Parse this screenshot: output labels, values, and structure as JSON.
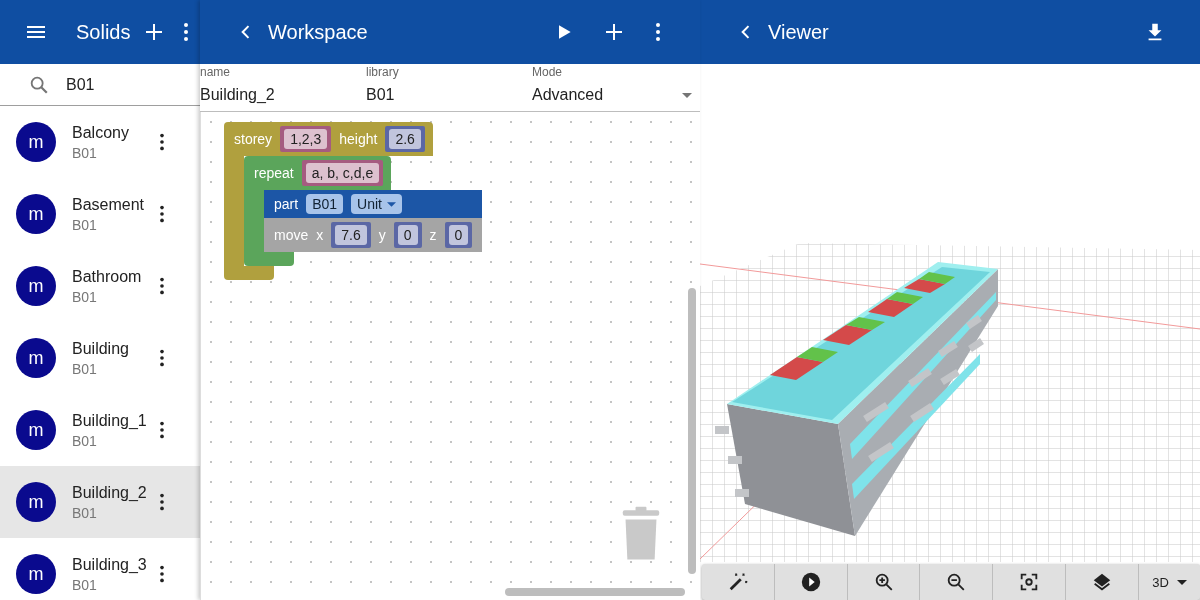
{
  "sidebar": {
    "title": "Solids",
    "search": {
      "value": "B01"
    },
    "items": [
      {
        "avatar": "m",
        "name": "Balcony",
        "library": "B01",
        "selected": false
      },
      {
        "avatar": "m",
        "name": "Basement",
        "library": "B01",
        "selected": false
      },
      {
        "avatar": "m",
        "name": "Bathroom",
        "library": "B01",
        "selected": false
      },
      {
        "avatar": "m",
        "name": "Building",
        "library": "B01",
        "selected": false
      },
      {
        "avatar": "m",
        "name": "Building_1",
        "library": "B01",
        "selected": false
      },
      {
        "avatar": "m",
        "name": "Building_2",
        "library": "B01",
        "selected": true
      },
      {
        "avatar": "m",
        "name": "Building_3",
        "library": "B01",
        "selected": false
      }
    ]
  },
  "workspace": {
    "title": "Workspace",
    "fields": [
      {
        "kind": "text",
        "label": "name",
        "value": "Building_2"
      },
      {
        "kind": "text",
        "label": "library",
        "value": "B01"
      },
      {
        "kind": "select",
        "label": "Mode",
        "value": "Advanced"
      }
    ],
    "blocks": [
      {
        "kind": "c",
        "color": "#b0a03e",
        "parts": [
          {
            "kind": "label",
            "text": "storey"
          },
          {
            "kind": "input",
            "value": "1,2,3",
            "color": "#a55b80"
          },
          {
            "kind": "label",
            "text": "height"
          },
          {
            "kind": "input",
            "value": "2.6",
            "color": "#5b67a5"
          }
        ],
        "children": [
          {
            "kind": "c",
            "color": "#5ba55b",
            "parts": [
              {
                "kind": "label",
                "text": "repeat"
              },
              {
                "kind": "input",
                "value": "a, b, c,d,e",
                "color": "#a55b80"
              }
            ],
            "children": [
              {
                "kind": "statement",
                "color": "#1c56a6",
                "parts": [
                  {
                    "kind": "label",
                    "text": "part"
                  },
                  {
                    "kind": "field",
                    "text": "B01"
                  },
                  {
                    "kind": "dropdown",
                    "text": "Unit"
                  }
                ]
              },
              {
                "kind": "statement",
                "color": "#a5a5a5",
                "parts": [
                  {
                    "kind": "label",
                    "text": "move"
                  },
                  {
                    "kind": "label",
                    "text": "x"
                  },
                  {
                    "kind": "input",
                    "value": "7.6",
                    "color": "#5b67a5"
                  },
                  {
                    "kind": "label",
                    "text": "y"
                  },
                  {
                    "kind": "input",
                    "value": "0",
                    "color": "#5b67a5"
                  },
                  {
                    "kind": "label",
                    "text": "z"
                  },
                  {
                    "kind": "input",
                    "value": "0",
                    "color": "#5b67a5"
                  }
                ]
              }
            ]
          }
        ]
      }
    ]
  },
  "viewer": {
    "title": "Viewer",
    "view_mode": "3D"
  }
}
